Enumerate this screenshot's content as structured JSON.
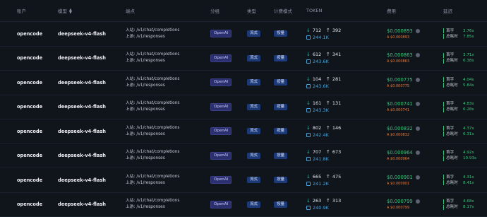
{
  "headers": {
    "account": "账户",
    "model": "模型",
    "endpoint": "端点",
    "group": "分组",
    "type": "类型",
    "billing": "计费模式",
    "token": "TOKEN",
    "cost": "费用",
    "latency": "延迟"
  },
  "labels": {
    "inbound_prefix": "入站:",
    "upstream_prefix": "上游:",
    "first_token": "首字",
    "total_time": "总耗时"
  },
  "colors": {
    "accent_green": "#35c77b",
    "accent_orange": "#e57b35",
    "accent_blue": "#4aa3d8",
    "teal": "#36b9a8"
  },
  "rows": [
    {
      "account": "opencode",
      "model": "deepseek-v4-flash",
      "inbound": "/v1/chat/completions",
      "upstream": "/v1/responses",
      "group": "OpenAI",
      "type": "流式",
      "billing": "按量",
      "tok_in": "712",
      "tok_out": "392",
      "tok_total": "244.1K",
      "cost": "$0.000893",
      "cost_sub": "A $0.000893",
      "first": "3.76s",
      "total": "7.85s"
    },
    {
      "account": "opencode",
      "model": "deepseek-v4-flash",
      "inbound": "/v1/chat/completions",
      "upstream": "/v1/responses",
      "group": "OpenAI",
      "type": "流式",
      "billing": "按量",
      "tok_in": "612",
      "tok_out": "341",
      "tok_total": "243.6K",
      "cost": "$0.000863",
      "cost_sub": "A $0.000863",
      "first": "3.71s",
      "total": "6.38s"
    },
    {
      "account": "opencode",
      "model": "deepseek-v4-flash",
      "inbound": "/v1/chat/completions",
      "upstream": "/v1/responses",
      "group": "OpenAI",
      "type": "流式",
      "billing": "按量",
      "tok_in": "104",
      "tok_out": "281",
      "tok_total": "243.6K",
      "cost": "$0.000775",
      "cost_sub": "A $0.000775",
      "first": "4.04s",
      "total": "5.84s"
    },
    {
      "account": "opencode",
      "model": "deepseek-v4-flash",
      "inbound": "/v1/chat/completions",
      "upstream": "/v1/responses",
      "group": "OpenAI",
      "type": "流式",
      "billing": "按量",
      "tok_in": "161",
      "tok_out": "131",
      "tok_total": "243.3K",
      "cost": "$0.000741",
      "cost_sub": "A $0.000741",
      "first": "4.83s",
      "total": "6.28s"
    },
    {
      "account": "opencode",
      "model": "deepseek-v4-flash",
      "inbound": "/v1/chat/completions",
      "upstream": "/v1/responses",
      "group": "OpenAI",
      "type": "流式",
      "billing": "按量",
      "tok_in": "802",
      "tok_out": "146",
      "tok_total": "242.4K",
      "cost": "$0.000832",
      "cost_sub": "A $0.000832",
      "first": "4.37s",
      "total": "6.31s"
    },
    {
      "account": "opencode",
      "model": "deepseek-v4-flash",
      "inbound": "/v1/chat/completions",
      "upstream": "/v1/responses",
      "group": "OpenAI",
      "type": "流式",
      "billing": "按量",
      "tok_in": "707",
      "tok_out": "673",
      "tok_total": "241.8K",
      "cost": "$0.000964",
      "cost_sub": "A $0.000964",
      "first": "4.92s",
      "total": "10.93s"
    },
    {
      "account": "opencode",
      "model": "deepseek-v4-flash",
      "inbound": "/v1/chat/completions",
      "upstream": "/v1/responses",
      "group": "OpenAI",
      "type": "流式",
      "billing": "按量",
      "tok_in": "665",
      "tok_out": "475",
      "tok_total": "241.2K",
      "cost": "$0.000901",
      "cost_sub": "A $0.000901",
      "first": "4.31s",
      "total": "8.41s"
    },
    {
      "account": "opencode",
      "model": "deepseek-v4-flash",
      "inbound": "/v1/chat/completions",
      "upstream": "/v1/responses",
      "group": "OpenAI",
      "type": "流式",
      "billing": "按量",
      "tok_in": "263",
      "tok_out": "313",
      "tok_total": "240.9K",
      "cost": "$0.000799",
      "cost_sub": "A $0.000799",
      "first": "4.68s",
      "total": "8.17s"
    }
  ]
}
